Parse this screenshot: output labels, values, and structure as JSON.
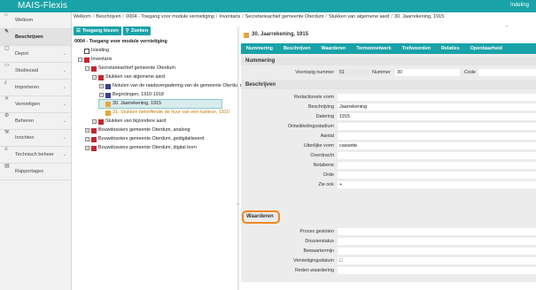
{
  "app": {
    "title": "MAIS-Flexis",
    "top_right": "Indeling"
  },
  "colors": {
    "accent": "#19a2a8",
    "highlight": "#f0861f"
  },
  "sidebar": {
    "items": [
      {
        "label": "Welkom",
        "icon": "home-icon",
        "has_chevron": false,
        "active": false
      },
      {
        "label": "Beschrijven",
        "icon": "edit-icon",
        "has_chevron": false,
        "active": true
      },
      {
        "label": "Depot",
        "icon": "box-icon",
        "has_chevron": true,
        "active": false
      },
      {
        "label": "Studiezaal",
        "icon": "desk-icon",
        "has_chevron": true,
        "active": false
      },
      {
        "label": "Importeren",
        "icon": "download-icon",
        "has_chevron": true,
        "active": false
      },
      {
        "label": "Vernietigen",
        "icon": "trash-icon",
        "has_chevron": true,
        "active": false
      },
      {
        "label": "Beheren",
        "icon": "gear-icon",
        "has_chevron": true,
        "active": false
      },
      {
        "label": "Inrichten",
        "icon": "wrench-icon",
        "has_chevron": true,
        "active": false
      },
      {
        "label": "Technisch beheer",
        "icon": "server-icon",
        "has_chevron": true,
        "active": false
      },
      {
        "label": "Rapportages",
        "icon": "report-icon",
        "has_chevron": false,
        "active": false
      }
    ]
  },
  "breadcrumb": [
    "Welkom",
    "Beschrijven",
    "0004 - Toegang voor module vernietiging",
    "Inventaris",
    "Secretarieachief gemeente Oterdum",
    "Stukken van algemene aard",
    "30. Jaarrekening, 1915"
  ],
  "tree": {
    "buttons": {
      "toegang": "Toegang kiezen",
      "zoeken": "Zoeken"
    },
    "rows": [
      {
        "label": "0004 - Toegang voor module vernietiging",
        "level": 0,
        "toggle": "",
        "icon": "",
        "bold": true
      },
      {
        "label": "Inleiding",
        "level": 1,
        "toggle": "",
        "icon": "lines"
      },
      {
        "label": "Inventaris",
        "level": 1,
        "toggle": "−",
        "icon": "red"
      },
      {
        "label": "Secretarieachief gemeente Oterdum",
        "level": 2,
        "toggle": "−",
        "icon": "red"
      },
      {
        "label": "Stukken van algemene aard",
        "level": 3,
        "toggle": "−",
        "icon": "red"
      },
      {
        "label": "Notulen van de raadsvergadering van de gemeente Oterdum, 1910-1919",
        "level": 4,
        "toggle": "+",
        "icon": "navy"
      },
      {
        "label": "Begrotingen, 1910-1918",
        "level": 4,
        "toggle": "+",
        "icon": "navy"
      },
      {
        "label": "30. Jaarrekening, 1915",
        "level": 4,
        "toggle": "",
        "icon": "orange",
        "selected": true
      },
      {
        "label": "31. Stukken betreffende de huur van een kantoor, 1910",
        "level": 4,
        "toggle": "",
        "icon": "orange",
        "orange": true
      },
      {
        "label": "Stukken van bijzondere aard",
        "level": 3,
        "toggle": "+",
        "icon": "red"
      },
      {
        "label": "Bouwdossiers gemeente Oterdum, analoog",
        "level": 2,
        "toggle": "+",
        "icon": "red"
      },
      {
        "label": "Bouwdossiers gemeente Oterdum, gedigitaliseerd",
        "level": 2,
        "toggle": "+",
        "icon": "red"
      },
      {
        "label": "Bouwdossiers gemeente Oterdum, digital born",
        "level": 2,
        "toggle": "+",
        "icon": "red"
      }
    ]
  },
  "detail": {
    "title": "30. Jaarrekening, 1915",
    "tabs": [
      "Nummering",
      "Beschrijven",
      "Waarderen",
      "Termennetwerk",
      "Trefwoorden",
      "Relaties",
      "Openbaarheid"
    ],
    "nummering": {
      "heading": "Nummering",
      "voorlopig_label": "Voorlopig nummer",
      "voorlopig_value": "51",
      "nummer_label": "Nummer",
      "nummer_value": "30",
      "code_label": "Code",
      "code_value": ""
    },
    "beschrijven": {
      "heading": "Beschrijven",
      "fields": [
        {
          "label": "Redactionele vorm",
          "value": ""
        },
        {
          "label": "Beschrijving",
          "value": "Jaarrekening"
        },
        {
          "label": "Datering",
          "value": "1915"
        },
        {
          "label": "Ontwikkelingsstadium",
          "value": ""
        },
        {
          "label": "Aantal",
          "value": ""
        },
        {
          "label": "Uiterlijke vorm",
          "value": "cassette"
        },
        {
          "label": "Overdracht",
          "value": ""
        },
        {
          "label": "Notabene",
          "value": ""
        },
        {
          "label": "Orde",
          "value": ""
        },
        {
          "label": "Zie ook",
          "value": "+"
        }
      ]
    },
    "waarderen": {
      "heading": "Waarderen",
      "fields": [
        {
          "label": "Proces gesloten",
          "value": ""
        },
        {
          "label": "Dossierstatus",
          "value": ""
        },
        {
          "label": "Bewaartermijn",
          "value": ""
        },
        {
          "label": "Vernietigingsdatum",
          "value": "□"
        },
        {
          "label": "Reden waardering",
          "value": ""
        }
      ]
    }
  }
}
